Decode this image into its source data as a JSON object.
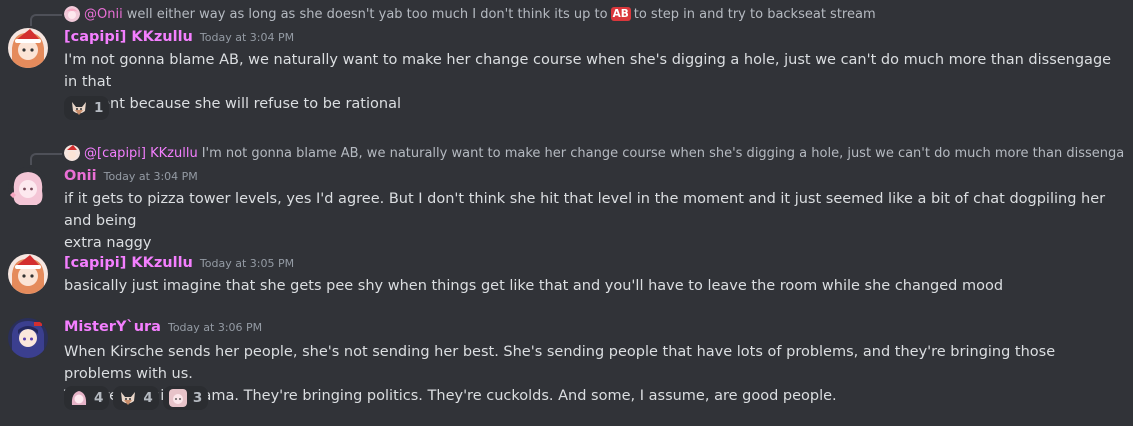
{
  "messages": [
    {
      "reply": {
        "author": "@Onii",
        "text_before": "well either way as long as she doesn't yab too much I don't think its up to",
        "badge": "AB",
        "text_after": "to step in and try to backseat stream"
      },
      "author": "[capipi] KKzullu",
      "timestamp": "Today at 3:04 PM",
      "lines": [
        "I'm not gonna blame AB, we naturally want to make her change course when she's digging a hole, just we can't do much more than dissengage in that",
        "moment because she will refuse to be rational"
      ],
      "reactions": [
        {
          "icon": "fox-emoji-icon",
          "count": "1"
        }
      ]
    },
    {
      "reply": {
        "author": "@[capipi] KKzullu",
        "text": "I'm not gonna blame AB, we naturally want to make her change course when she's digging a hole, just we can't do much more than dissengage in that momen"
      },
      "author": "Onii",
      "timestamp": "Today at 3:04 PM",
      "lines": [
        "if it gets to pizza tower levels, yes I'd agree. But I don't think she hit that level in the moment and it just seemed like a bit of chat dogpiling her and being",
        "extra naggy"
      ]
    },
    {
      "author": "[capipi] KKzullu",
      "timestamp": "Today at 3:05 PM",
      "lines": [
        "basically just imagine that she gets pee shy when things get like that and you'll have to leave the room while she changed mood"
      ]
    },
    {
      "author": "MisterY`ura",
      "timestamp": "Today at 3:06 PM",
      "lines": [
        "When Kirsche sends her people, she's not sending her best. She's sending people that have lots of problems, and they're bringing those problems with us.",
        "They're bringing drama. They're bringing politics. They're cuckolds. And some, I assume, are good people."
      ],
      "reactions": [
        {
          "icon": "pink-hair-emoji-icon",
          "count": "4"
        },
        {
          "icon": "fox-emoji-icon",
          "count": "4"
        },
        {
          "icon": "face-emoji-icon",
          "count": "3"
        }
      ]
    }
  ],
  "colors": {
    "background": "#313338",
    "username": "#f47fff",
    "timestamp": "#949ba4",
    "text": "#dbdee1",
    "badge": "#da373c"
  }
}
